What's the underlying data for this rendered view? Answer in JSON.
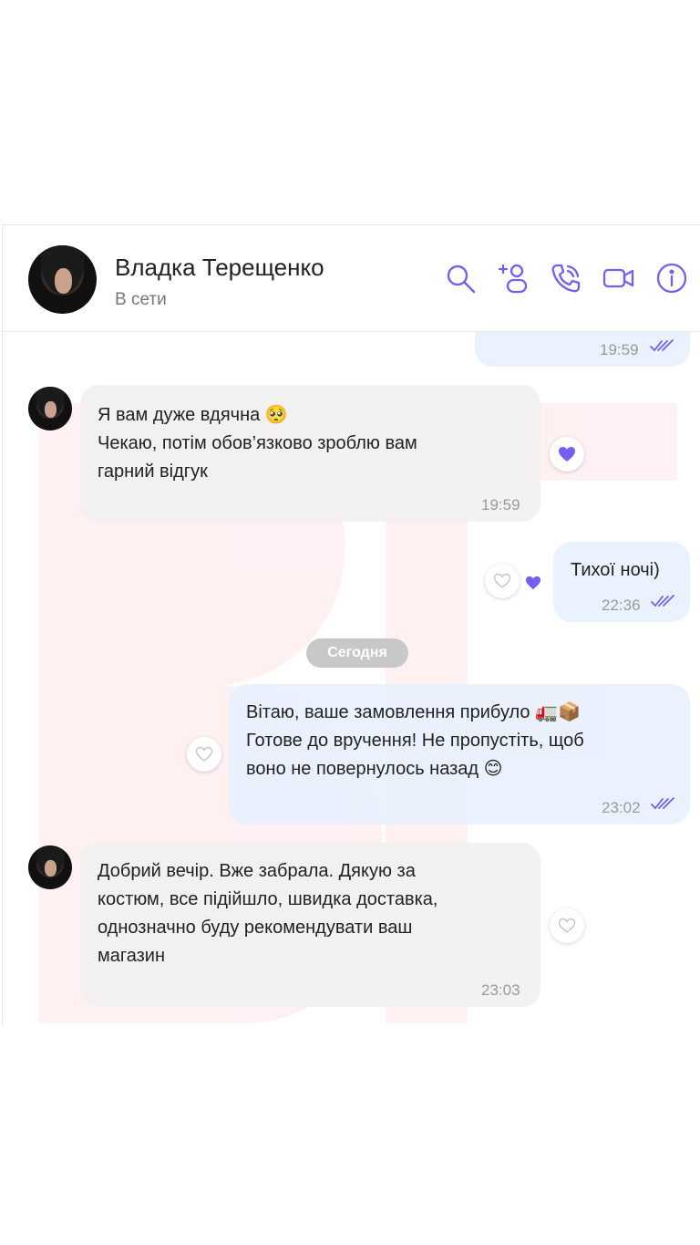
{
  "contact": {
    "name": "Владка Терещенко",
    "status": "В сети"
  },
  "header_icons": [
    "search-icon",
    "add-contact-icon",
    "voice-call-icon",
    "video-call-icon",
    "info-icon"
  ],
  "messages": [
    {
      "direction": "out",
      "text": "",
      "time": "19:59",
      "read": true
    },
    {
      "direction": "in",
      "text": "Я вам дуже вдячна 🥺\nЧекаю, потім обов’язково зроблю вам\nгарний відгук",
      "time": "19:59",
      "reaction": "filled-heart"
    },
    {
      "direction": "out",
      "text": "Тихої ночі)",
      "time": "22:36",
      "read": true,
      "reaction": "filled-heart"
    },
    {
      "direction": "out",
      "text": "Вітаю, ваше замовлення прибуло 🚛📦\nГотове до вручення! Не пропустіть, щоб\nвоно не повернулось назад 😊",
      "time": "23:02",
      "read": true
    },
    {
      "direction": "in",
      "text": "Добрий вечір. Вже забрала. Дякую за\nкостюм, все підійшло, швидка доставка,\nоднозначно буду рекомендувати ваш\nмагазин",
      "time": "23:03"
    }
  ],
  "date_separator": "Сегодня",
  "colors": {
    "accent": "#7360f2",
    "incoming_bubble": "#f0f0f0",
    "outgoing_bubble": "#e7f0ff",
    "watermark": "#ff3b5c"
  }
}
